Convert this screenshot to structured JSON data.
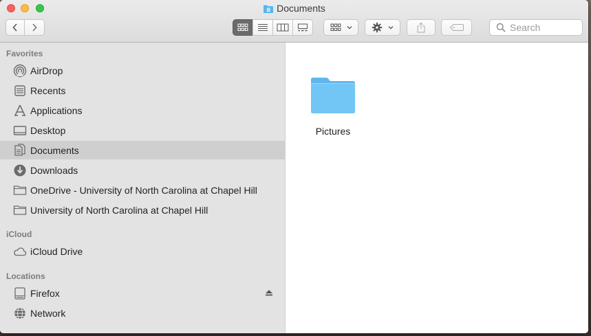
{
  "window": {
    "title": "Documents"
  },
  "toolbar": {
    "back_icon": "chevron-left-icon",
    "forward_icon": "chevron-right-icon",
    "view_modes": [
      "icon-view-icon",
      "list-view-icon",
      "column-view-icon",
      "gallery-view-icon"
    ],
    "selected_view": "icon-view-icon",
    "group_icon": "group-icon",
    "action_icon": "gear-icon",
    "share_icon": "share-icon",
    "tag_icon": "tag-icon"
  },
  "search": {
    "placeholder": "Search",
    "value": ""
  },
  "sidebar": {
    "favorites": {
      "label": "Favorites",
      "items": [
        {
          "label": "AirDrop",
          "icon": "airdrop-icon"
        },
        {
          "label": "Recents",
          "icon": "recents-icon"
        },
        {
          "label": "Applications",
          "icon": "applications-icon"
        },
        {
          "label": "Desktop",
          "icon": "desktop-icon"
        },
        {
          "label": "Documents",
          "icon": "documents-icon",
          "selected": true
        },
        {
          "label": "Downloads",
          "icon": "downloads-icon"
        },
        {
          "label": "OneDrive - University of North Carolina at Chapel Hill",
          "icon": "folder-icon"
        },
        {
          "label": "University of North Carolina at Chapel Hill",
          "icon": "folder-icon"
        }
      ]
    },
    "icloud": {
      "label": "iCloud",
      "items": [
        {
          "label": "iCloud Drive",
          "icon": "cloud-icon"
        }
      ]
    },
    "locations": {
      "label": "Locations",
      "items": [
        {
          "label": "Firefox",
          "icon": "disk-icon",
          "eject": true
        },
        {
          "label": "Network",
          "icon": "network-icon"
        }
      ]
    }
  },
  "content": {
    "items": [
      {
        "name": "Pictures",
        "icon": "folder-icon"
      }
    ]
  },
  "colors": {
    "folder": "#6cc4f5",
    "selected_row": "#cfcfcf",
    "sidebar_bg": "#e3e3e3"
  }
}
